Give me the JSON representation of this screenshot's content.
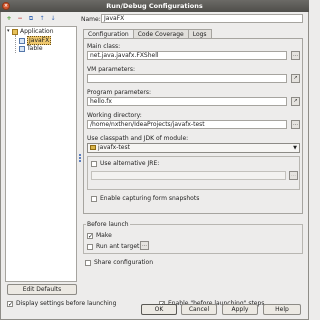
{
  "window": {
    "title": "Run/Debug Configurations",
    "close_glyph": "×"
  },
  "toolbar": {
    "add": "+",
    "remove": "−",
    "copy": "⧉",
    "up": "↑",
    "down": "↓"
  },
  "name": {
    "label": "Name:",
    "value": "JavaFX"
  },
  "tree": {
    "root": "Application",
    "items": [
      "JavaFX",
      "Table"
    ]
  },
  "tabs": [
    "Configuration",
    "Code Coverage",
    "Logs"
  ],
  "config": {
    "main_class_label": "Main class:",
    "main_class_value": "net.java.javafx.FXShell",
    "vm_params_label": "VM parameters:",
    "vm_params_value": "",
    "program_params_label": "Program parameters:",
    "program_params_value": "hello.fx",
    "workdir_label": "Working directory:",
    "workdir_value": "/home/nxthen/IdeaProjects/javafx-test",
    "classpath_label": "Use classpath and JDK of module:",
    "module_value": "javafx-test",
    "alt_jre_label": "Use alternative JRE:",
    "snapshot_label": "Enable capturing form snapshots",
    "browse_glyph": "…",
    "expand_glyph": "↗",
    "combo_arrow": "▼"
  },
  "before_launch": {
    "title": "Before launch",
    "make_label": "Make",
    "ant_label": "Run ant target",
    "check_glyph": "✓"
  },
  "share_label": "Share configuration",
  "edit_defaults_label": "Edit Defaults",
  "display_settings_label": "Display settings before launching",
  "enable_before_label": "Enable \"before launching\" steps",
  "buttons": {
    "ok": "OK",
    "cancel": "Cancel",
    "apply": "Apply",
    "help": "Help"
  }
}
